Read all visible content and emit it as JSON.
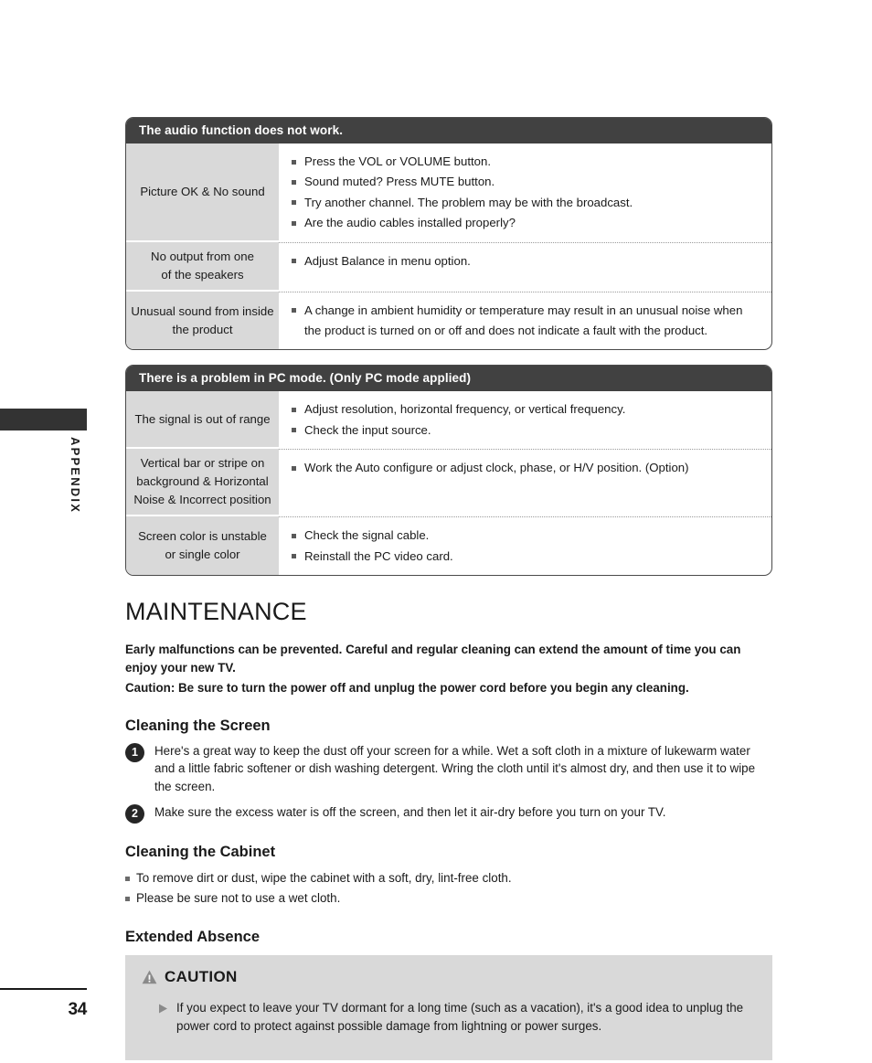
{
  "sidebar": {
    "section_label": "APPENDIX",
    "page_number": "34"
  },
  "tables": [
    {
      "header": "The audio function does not work.",
      "rows": [
        {
          "label": "Picture OK & No sound",
          "items": [
            "Press the VOL or VOLUME button.",
            "Sound muted? Press MUTE button.",
            "Try another channel. The problem may be with the broadcast.",
            "Are the audio cables installed properly?"
          ]
        },
        {
          "label": "No output from one\nof the speakers",
          "items": [
            "Adjust Balance in menu option."
          ]
        },
        {
          "label": "Unusual sound from inside\nthe product",
          "items": [
            "A change in ambient humidity or temperature may result in an unusual noise when the product is turned on or off and does not indicate a fault with the product."
          ]
        }
      ]
    },
    {
      "header": "There is a problem in PC mode. (Only PC mode applied)",
      "rows": [
        {
          "label": "The signal is out of range",
          "items": [
            "Adjust resolution, horizontal frequency, or vertical frequency.",
            "Check the input source."
          ]
        },
        {
          "label": "Vertical bar or stripe on\nbackground & Horizontal\nNoise & Incorrect position",
          "items": [
            "Work the Auto configure or adjust clock, phase, or H/V position. (Option)"
          ]
        },
        {
          "label": "Screen color is unstable\nor single color",
          "items": [
            "Check the signal cable.",
            "Reinstall the PC video card."
          ]
        }
      ]
    }
  ],
  "maintenance": {
    "title": "MAINTENANCE",
    "intro_line_1": "Early malfunctions can be prevented. Careful and regular cleaning can extend the amount of time you can enjoy your new TV.",
    "intro_line_2": "Caution: Be sure to turn the power off and unplug the power cord before you begin any cleaning.",
    "cleaning_screen": {
      "title": "Cleaning the Screen",
      "steps": [
        {
          "number": "1",
          "text": "Here's a great way to keep the dust off your screen for a while. Wet a soft cloth in a mixture of lukewarm water and a little fabric softener or dish washing detergent. Wring the cloth until it's almost dry, and then use it to wipe the screen."
        },
        {
          "number": "2",
          "text": "Make sure the excess water is off the screen, and then let it air-dry before you turn on your TV."
        }
      ]
    },
    "cleaning_cabinet": {
      "title": "Cleaning the Cabinet",
      "items": [
        "To remove dirt or dust, wipe the cabinet with a soft, dry, lint-free cloth.",
        "Please be sure not to use a wet cloth."
      ]
    },
    "extended_absence": {
      "title": "Extended Absence"
    },
    "caution": {
      "title": "CAUTION",
      "icon": "warning-triangle-icon",
      "text": "If you expect to leave your TV dormant for a long time (such as a vacation), it's a good idea to unplug the power cord to protect against possible damage from lightning or power surges."
    }
  },
  "colors": {
    "table_header_bg": "#414141",
    "table_label_bg": "#d9d9d9",
    "caution_bg": "#d9d9d9",
    "side_tab": "#333333"
  }
}
